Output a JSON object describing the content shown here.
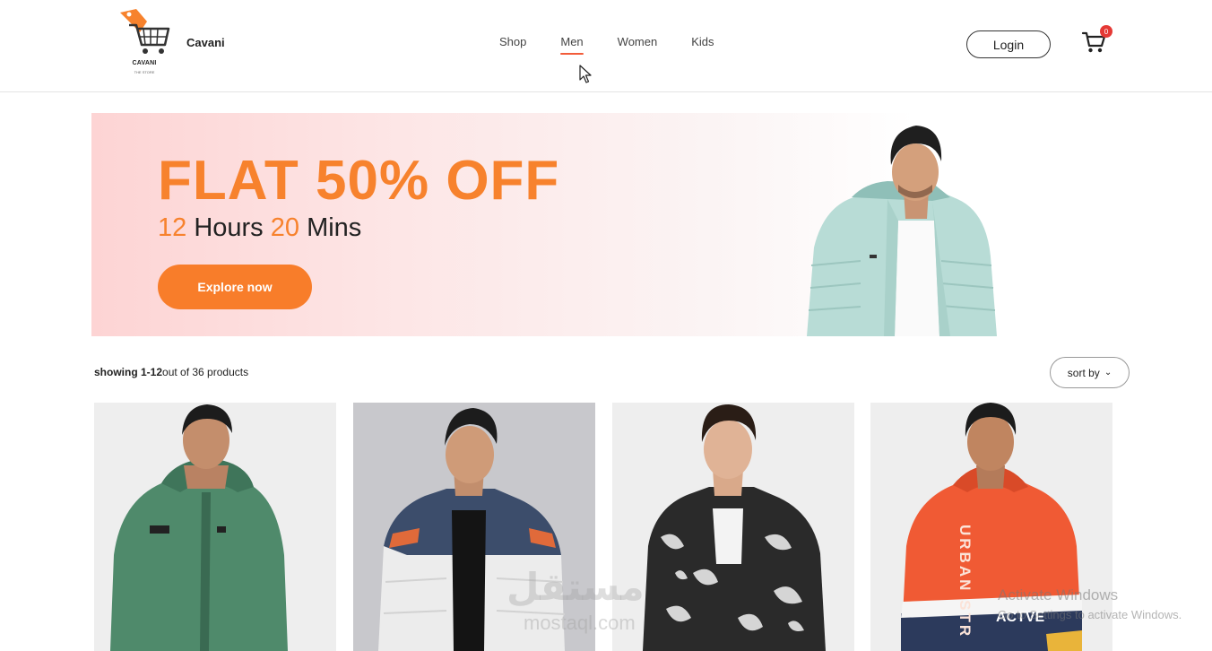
{
  "header": {
    "brand": "Cavani",
    "logo_text": "CAVANI",
    "logo_sub": "THE STORE",
    "nav": [
      {
        "label": "Shop"
      },
      {
        "label": "Men",
        "active": true
      },
      {
        "label": "Women"
      },
      {
        "label": "Kids"
      }
    ],
    "login_label": "Login",
    "cart_count": "0",
    "icons": {
      "cart": "cart-icon",
      "cursor": "mouse-cursor-icon",
      "logo": "shopping-cart-logo"
    }
  },
  "banner": {
    "headline": "FLAT 50% OFF",
    "hours_num": "12",
    "hours_word": " Hours ",
    "mins_num": "20",
    "mins_word": " Mins",
    "cta_label": "Explore now"
  },
  "listing": {
    "showing_range": "showing 1-12",
    "showing_rest": "out of 36 products",
    "sort_label": "sort by",
    "sort_icon": "chevron-down-icon"
  },
  "products": [
    {
      "name": "green-hoodie-jacket",
      "color": "#4f8a6b"
    },
    {
      "name": "white-navy-puffer-jacket",
      "color": "#3c4d6b"
    },
    {
      "name": "black-print-bomber-jacket",
      "color": "#2a2a2a"
    },
    {
      "name": "red-urban-windcheater",
      "color": "#f05a34"
    }
  ],
  "product_text": {
    "urban": "URBAN STR",
    "active": "ACTVE"
  },
  "watermarks": {
    "line1": "Activate Windows",
    "line2": "Go to Settings to activate Windows.",
    "site_ar": "مستقل",
    "site": "mostaql.com"
  },
  "colors": {
    "accent": "#f7822d",
    "nav_underline": "#f25c3a",
    "badge": "#e53935"
  }
}
